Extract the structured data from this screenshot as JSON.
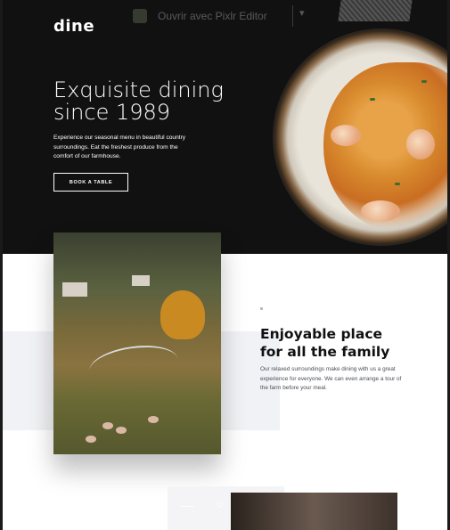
{
  "brand": {
    "logo": "dine"
  },
  "toolbar": {
    "label": "Ouvrir avec Pixlr Editor",
    "chevron": "▾"
  },
  "hero": {
    "title": "Exquisite dining\nsince 1989",
    "description": "Experience our seasonal menu in beautiful country surroundings. Eat the freshest produce from the comfort of our farmhouse.",
    "cta_label": "BOOK A TABLE"
  },
  "family_section": {
    "tag": "",
    "title": "Enjoyable place\nfor all the family",
    "description": "Our relaxed surroundings make dining with us a great experience for everyone. We can even arrange a tour of the farm before your meal."
  },
  "bottom": {
    "icon_left": "—",
    "icon_right": "○"
  },
  "colors": {
    "hero_bg": "#111111",
    "accent": "#c1a16d",
    "grey_block": "#f1f2f5"
  }
}
